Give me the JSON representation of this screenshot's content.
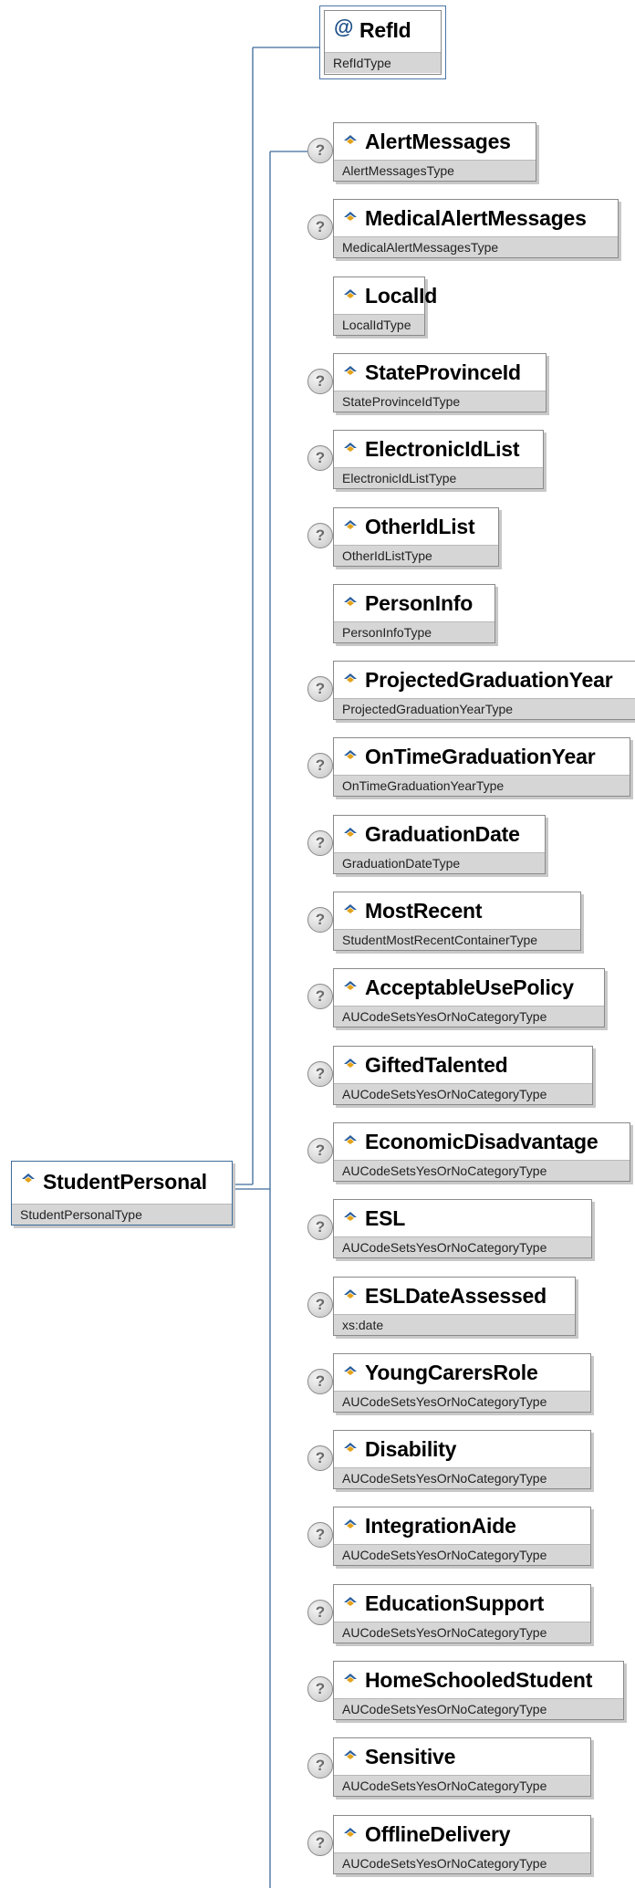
{
  "root": {
    "name": "StudentPersonal",
    "type": "StudentPersonalType",
    "icon": "element-icon"
  },
  "attribute": {
    "symbol": "@",
    "name": "RefId",
    "type": "RefIdType"
  },
  "optional_marker": "?",
  "colors": {
    "connector": "#3d6b9b",
    "type_band": "#d6d6d6",
    "icon_blue": "#2b5f9e",
    "icon_gold": "#e3a21a"
  },
  "children": [
    {
      "name": "AlertMessages",
      "type": "AlertMessagesType",
      "optional": true
    },
    {
      "name": "MedicalAlertMessages",
      "type": "MedicalAlertMessagesType",
      "optional": true
    },
    {
      "name": "LocalId",
      "type": "LocalIdType",
      "optional": false
    },
    {
      "name": "StateProvinceId",
      "type": "StateProvinceIdType",
      "optional": true
    },
    {
      "name": "ElectronicIdList",
      "type": "ElectronicIdListType",
      "optional": true
    },
    {
      "name": "OtherIdList",
      "type": "OtherIdListType",
      "optional": true
    },
    {
      "name": "PersonInfo",
      "type": "PersonInfoType",
      "optional": false
    },
    {
      "name": "ProjectedGraduationYear",
      "type": "ProjectedGraduationYearType",
      "optional": true
    },
    {
      "name": "OnTimeGraduationYear",
      "type": "OnTimeGraduationYearType",
      "optional": true
    },
    {
      "name": "GraduationDate",
      "type": "GraduationDateType",
      "optional": true
    },
    {
      "name": "MostRecent",
      "type": "StudentMostRecentContainerType",
      "optional": true
    },
    {
      "name": "AcceptableUsePolicy",
      "type": "AUCodeSetsYesOrNoCategoryType",
      "optional": true
    },
    {
      "name": "GiftedTalented",
      "type": "AUCodeSetsYesOrNoCategoryType",
      "optional": true
    },
    {
      "name": "EconomicDisadvantage",
      "type": "AUCodeSetsYesOrNoCategoryType",
      "optional": true
    },
    {
      "name": "ESL",
      "type": "AUCodeSetsYesOrNoCategoryType",
      "optional": true
    },
    {
      "name": "ESLDateAssessed",
      "type": "xs:date",
      "optional": true
    },
    {
      "name": "YoungCarersRole",
      "type": "AUCodeSetsYesOrNoCategoryType",
      "optional": true
    },
    {
      "name": "Disability",
      "type": "AUCodeSetsYesOrNoCategoryType",
      "optional": true
    },
    {
      "name": "IntegrationAide",
      "type": "AUCodeSetsYesOrNoCategoryType",
      "optional": true
    },
    {
      "name": "EducationSupport",
      "type": "AUCodeSetsYesOrNoCategoryType",
      "optional": true
    },
    {
      "name": "HomeSchooledStudent",
      "type": "AUCodeSetsYesOrNoCategoryType",
      "optional": true
    },
    {
      "name": "Sensitive",
      "type": "AUCodeSetsYesOrNoCategoryType",
      "optional": true
    },
    {
      "name": "OfflineDelivery",
      "type": "AUCodeSetsYesOrNoCategoryType",
      "optional": true
    }
  ]
}
